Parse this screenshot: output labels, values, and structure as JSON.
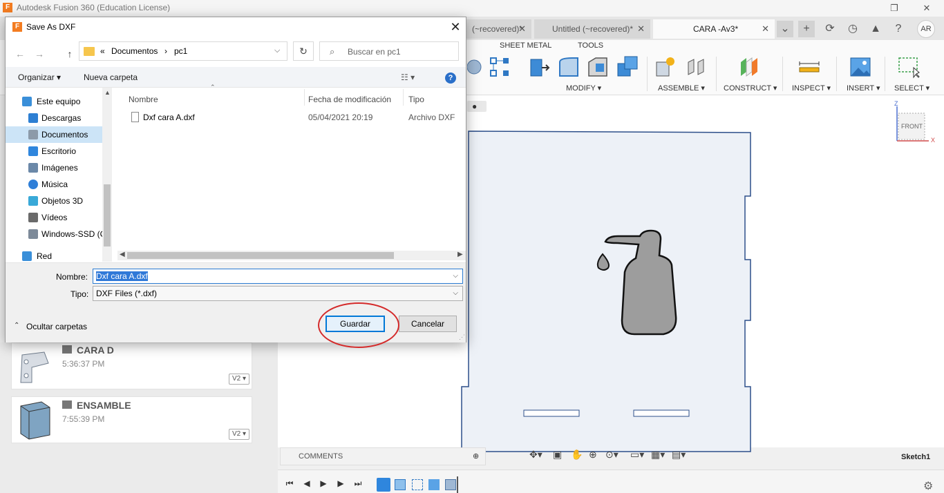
{
  "app": {
    "title": "Autodesk Fusion 360 (Education License)",
    "logo_letter": "F",
    "tabs": [
      {
        "label": "(~recovered)*"
      },
      {
        "label": "Untitled (~recovered)*"
      },
      {
        "label": "CARA -Av3*"
      }
    ],
    "user_initials": "AR"
  },
  "ribbon": {
    "tabs": [
      "SHEET METAL",
      "TOOLS"
    ],
    "groups": {
      "modify": "MODIFY ▾",
      "assemble": "ASSEMBLE ▾",
      "construct": "CONSTRUCT ▾",
      "inspect": "INSPECT ▾",
      "insert": "INSERT ▾",
      "select": "SELECT ▾"
    }
  },
  "viewcube": {
    "z_label": "Z",
    "x_label": "X",
    "face": "FRONT"
  },
  "data_panel": {
    "items": [
      {
        "title": "CARA D",
        "time": "5:36:37 PM",
        "version": "V2 ▾"
      },
      {
        "title": "ENSAMBLE",
        "time": "7:55:39 PM",
        "version": "V2 ▾"
      }
    ]
  },
  "bottom": {
    "comments_label": "COMMENTS",
    "active_sketch": "Sketch1"
  },
  "dialog": {
    "title": "Save As DXF",
    "icon_letter": "F",
    "close_glyph": "✕",
    "breadcrumb": {
      "prefix": "«",
      "parts": [
        "Documentos",
        "pc1"
      ],
      "sep": "›"
    },
    "search_placeholder": "Buscar en pc1",
    "commands": {
      "organize": "Organizar ▾",
      "new_folder": "Nueva carpeta"
    },
    "tree": [
      {
        "label": "Este equipo",
        "icon": "computer-icon",
        "color": "#3a8fd9"
      },
      {
        "label": "Descargas",
        "icon": "download-icon",
        "color": "#2d7fd3"
      },
      {
        "label": "Documentos",
        "icon": "document-icon",
        "color": "#8c9aa9",
        "selected": true
      },
      {
        "label": "Escritorio",
        "icon": "desktop-icon",
        "color": "#2f86dd"
      },
      {
        "label": "Imágenes",
        "icon": "pictures-icon",
        "color": "#6b88a8"
      },
      {
        "label": "Música",
        "icon": "music-icon",
        "color": "#2f7fd8"
      },
      {
        "label": "Objetos 3D",
        "icon": "cube-icon",
        "color": "#39a9d8"
      },
      {
        "label": "Vídeos",
        "icon": "video-icon",
        "color": "#6a6a6a"
      },
      {
        "label": "Windows-SSD (C",
        "icon": "drive-icon",
        "color": "#7d8a99"
      },
      {
        "label": "Red",
        "icon": "network-icon",
        "color": "#3a8fd9"
      }
    ],
    "columns": {
      "name": "Nombre",
      "modified": "Fecha de modificación",
      "type": "Tipo"
    },
    "files": [
      {
        "name": "Dxf cara A.dxf",
        "modified": "05/04/2021 20:19",
        "type": "Archivo DXF"
      }
    ],
    "filename_label": "Nombre:",
    "filename_value": "Dxf cara A.dxf",
    "type_label": "Tipo:",
    "type_value": "DXF Files (*.dxf)",
    "hide_folders": "Ocultar carpetas",
    "save_button": "Guardar",
    "cancel_button": "Cancelar"
  }
}
